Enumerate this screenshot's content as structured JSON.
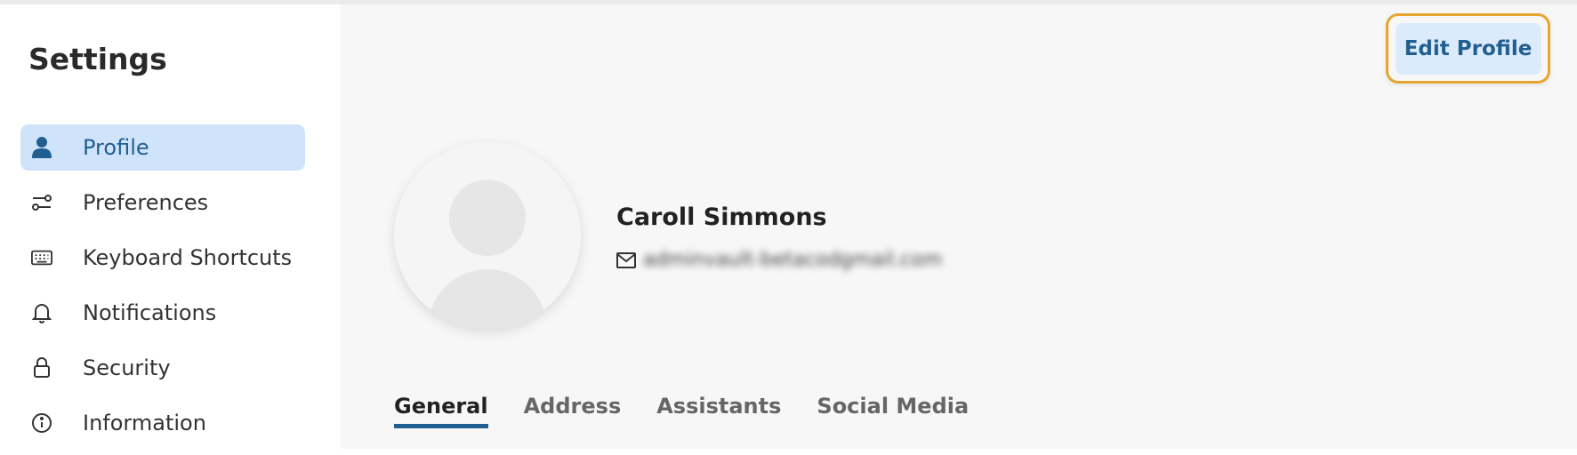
{
  "sidebar": {
    "title": "Settings",
    "items": [
      {
        "label": "Profile",
        "icon": "person-icon",
        "active": true
      },
      {
        "label": "Preferences",
        "icon": "sliders-icon",
        "active": false
      },
      {
        "label": "Keyboard Shortcuts",
        "icon": "keyboard-icon",
        "active": false
      },
      {
        "label": "Notifications",
        "icon": "bell-icon",
        "active": false
      },
      {
        "label": "Security",
        "icon": "lock-icon",
        "active": false
      },
      {
        "label": "Information",
        "icon": "info-icon",
        "active": false
      }
    ]
  },
  "header": {
    "edit_profile_label": "Edit Profile"
  },
  "profile": {
    "name": "Caroll Simmons",
    "email": "adminvault-betacodgmail.com"
  },
  "tabs": [
    {
      "label": "General",
      "active": true
    },
    {
      "label": "Address",
      "active": false
    },
    {
      "label": "Assistants",
      "active": false
    },
    {
      "label": "Social Media",
      "active": false
    }
  ],
  "colors": {
    "accent": "#225f91",
    "active_bg": "#cfe4fb",
    "focus_ring": "#e6a52e",
    "main_bg": "#f7f7f7"
  }
}
